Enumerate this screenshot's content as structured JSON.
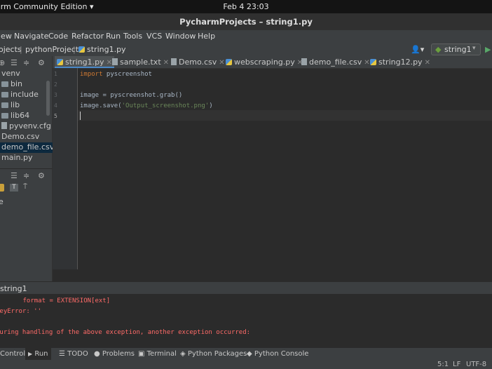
{
  "system": {
    "app_menu": "arm Community Edition",
    "clock": "Feb 4  23:03"
  },
  "window": {
    "title": "PycharmProjects – string1.py"
  },
  "menu": [
    "iew",
    "Navigate",
    "Code",
    "Refactor",
    "Run",
    "Tools",
    "VCS",
    "Window",
    "Help"
  ],
  "breadcrumb": {
    "project": "ojects",
    "sub": "pythonProject",
    "file": "string1.py"
  },
  "run_config": {
    "label": "string1"
  },
  "project_tree": [
    {
      "label": "venv",
      "type": "folder"
    },
    {
      "label": "bin",
      "type": "folder"
    },
    {
      "label": "include",
      "type": "folder"
    },
    {
      "label": "lib",
      "type": "folder"
    },
    {
      "label": "lib64",
      "type": "folder"
    },
    {
      "label": "pyvenv.cfg",
      "type": "file"
    },
    {
      "label": "Demo.csv",
      "type": "file"
    },
    {
      "label": "demo_file.csv",
      "type": "file",
      "selected": true
    },
    {
      "label": "main.py",
      "type": "file"
    }
  ],
  "structure": {
    "item": "e"
  },
  "tabs": [
    {
      "label": "string1.py",
      "active": true
    },
    {
      "label": "sample.txt"
    },
    {
      "label": "Demo.csv"
    },
    {
      "label": "webscraping.py"
    },
    {
      "label": "demo_file.csv"
    },
    {
      "label": "string12.py"
    }
  ],
  "code": {
    "line_numbers": [
      "1",
      "2",
      "3",
      "4",
      "5"
    ],
    "line1_kw": "import",
    "line1_rest": " pyscreenshot",
    "line3": "image = pyscreenshot.grab()",
    "line4_pre": "image.save(",
    "line4_str": "'Output_screenshot.png'",
    "line4_post": ")"
  },
  "run": {
    "title": "string1",
    "output": [
      "      format = EXTENSION[ext]",
      "KeyError: ''",
      "",
      "During handling of the above exception, another exception occurred:"
    ]
  },
  "bottom_tools": [
    "Control",
    "Run",
    "TODO",
    "Problems",
    "Terminal",
    "Python Packages",
    "Python Console"
  ],
  "status": {
    "position": "5:1",
    "line_sep": "LF",
    "encoding": "UTF-8"
  }
}
